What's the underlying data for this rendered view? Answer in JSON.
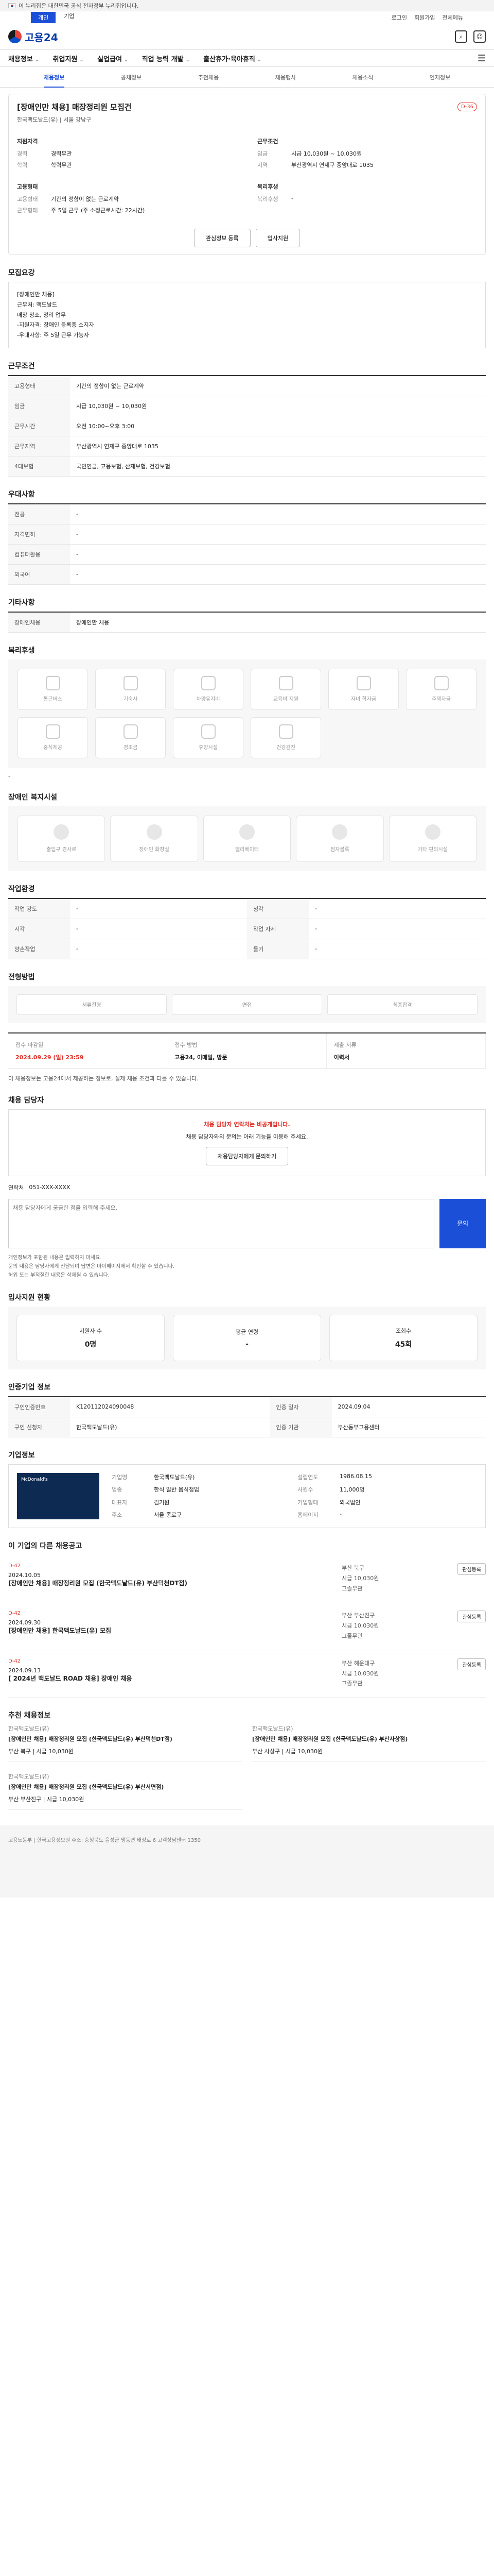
{
  "gov_strip": "이 누리집은 대한민국 공식 전자정부 누리집입니다.",
  "topbar": {
    "tabs": [
      "개인",
      "기업"
    ],
    "right": [
      "로그인",
      "회원가입",
      "전체메뉴"
    ]
  },
  "logo": "고용24",
  "gnb": [
    "채용정보",
    "취업지원",
    "실업급여",
    "직업 능력 개발",
    "출산휴가·육아휴직"
  ],
  "subnav": [
    "채용정보",
    "공채정보",
    "추천채용",
    "채용행사",
    "채용소식",
    "인재정보"
  ],
  "job": {
    "title": "[장애인만 채용] 매장정리원 모집건",
    "dday": "D-36",
    "company_line": "한국맥도날드(유)  |  서울 강남구",
    "left_head": "지원자격",
    "right_head": "근무조건",
    "left": [
      [
        "경력",
        "경력무관"
      ],
      [
        "학력",
        "학력무관"
      ]
    ],
    "right": [
      [
        "임금",
        "시급 10,030원 ~ 10,030원"
      ],
      [
        "지역",
        "부산광역시 연제구 중앙대로 1035"
      ]
    ],
    "left2_head": "고용형태",
    "left2": [
      [
        "고용형태",
        "기간의 정함이 없는 근로계약"
      ],
      [
        "근무형태",
        "주 5일 근무 (주 소정근로시간: 22시간)"
      ]
    ],
    "right2_head": "복리후생",
    "right2": [
      [
        "복리후생",
        "-"
      ]
    ],
    "buttons": [
      "관심정보 등록",
      "입사지원"
    ]
  },
  "section_recruit": "모집요강",
  "recruit_box": "[장애인만 채용]\n근무처: 맥도날드\n매장 청소, 정리 업무\n-지원자격: 장애인 등록증 소지자\n-우대사항: 주 5일 근무 가능자",
  "section_conditions": "근무조건",
  "conditions": [
    [
      "고용형태",
      "기간의 정함이 없는 근로계약"
    ],
    [
      "임금",
      "시급 10,030원 ~ 10,030원"
    ],
    [
      "근무시간",
      "오전 10:00~오후 3:00"
    ],
    [
      "근무지역",
      "부산광역시 연제구 중앙대로 1035"
    ],
    [
      "4대보험",
      "국민연금, 고용보험, 산재보험, 건강보험"
    ]
  ],
  "section_qual": "우대사항",
  "qual": [
    [
      "전공",
      "-"
    ],
    [
      "자격면허",
      "-"
    ],
    [
      "컴퓨터활용",
      "-"
    ],
    [
      "외국어",
      "-"
    ]
  ],
  "section_etc": "기타사항",
  "etc": [
    [
      "장애인채용",
      "장애인만 채용"
    ]
  ],
  "section_welfare_env": "복리후생",
  "welfare_icons": [
    "통근버스",
    "기숙사",
    "차량유지비",
    "교육비 지원",
    "자녀 학자금",
    "주택자금",
    "중식제공",
    "경조금",
    "휴양시설",
    "건강검진",
    "",
    ""
  ],
  "section_disabled": "장애인 복지시설",
  "disabled_icons": [
    "출입구 경사로",
    "장애인 화장실",
    "엘리베이터",
    "점자블록",
    "기타 편의시설"
  ],
  "section_work": "작업환경",
  "work": [
    [
      "작업 강도",
      "-"
    ],
    [
      "청각",
      "-"
    ],
    [
      "시각",
      "-"
    ],
    [
      "작업 자세",
      "-"
    ],
    [
      "양손작업",
      "-"
    ],
    [
      "들기",
      "-"
    ]
  ],
  "section_process": "전형방법",
  "process": [
    "서류전형",
    "면접",
    "최종합격"
  ],
  "apply": {
    "end_label": "접수 마감일",
    "end_value": "2024.09.29 (일) 23:59",
    "method_label": "접수 방법",
    "method_value": "고용24, 이메일, 방문",
    "docs_label": "제출 서류",
    "docs_value": "이력서"
  },
  "apply_note": "이 채용정보는 고용24에서 제공하는 정보로, 실제 채용 조건과 다를 수 있습니다.",
  "section_manager": "채용 담당자",
  "manager_warn": "채용 담당자 연락처는 비공개입니다.",
  "manager_text": "채용 담당자와의 문의는 아래 기능을 이용해 주세요.",
  "manager_button": "채용담당자에게 문의하기",
  "field_label": "연락처",
  "field_value": "051-XXX-XXXX",
  "qa_placeholder": "채용 담당자에게 궁금한 점을 입력해 주세요.",
  "qa_send": "문의",
  "bullets": [
    "개인정보가 포함된 내용은 입력하지 마세요.",
    "문의 내용은 담당자에게 전달되며 답변은 마이페이지에서 확인할 수 있습니다.",
    "허위 또는 부적절한 내용은 삭제될 수 있습니다."
  ],
  "section_status": "입사지원 현황",
  "stats": [
    [
      "지원자 수",
      "0명"
    ],
    [
      "평균 연령",
      "-"
    ],
    [
      "조회수",
      "45회"
    ]
  ],
  "section_info": "인증기업 정보",
  "info": [
    [
      "구인인증번호",
      "K120112024090048"
    ],
    [
      "인증 일자",
      "2024.09.04"
    ],
    [
      "구인 신청자",
      "한국맥도날드(유)"
    ],
    [
      "인증 기관",
      "부산동부고용센터"
    ]
  ],
  "section_company": "기업정보",
  "company_logo_text": "McDonald's",
  "company": [
    [
      "기업명",
      "한국맥도날드(유)"
    ],
    [
      "업종",
      "한식 일반 음식점업"
    ],
    [
      "대표자",
      "김기원"
    ],
    [
      "설립연도",
      "1986.08.15"
    ],
    [
      "사원수",
      "11,000명"
    ],
    [
      "기업형태",
      "외국법인"
    ],
    [
      "주소",
      "서울 종로구"
    ],
    [
      "홈페이지",
      "-"
    ]
  ],
  "section_other": "이 기업의 다른 채용공고",
  "other_jobs": [
    {
      "dday": "D-42",
      "date": "2024.10.05",
      "title": "[장애인만 채용] 매장정리원 모집 (한국맥도날드(유) 부산덕천DT점)",
      "meta": [
        "부산 북구",
        "시급 10,030원",
        "고졸무관"
      ],
      "fav": "관심등록"
    },
    {
      "dday": "D-42",
      "date": "2024.09.30",
      "title": "[장애인만 채용] 한국맥도날드(유) 모집",
      "meta": [
        "부산 부산진구",
        "시급 10,030원",
        "고졸무관"
      ],
      "fav": "관심등록"
    },
    {
      "dday": "D-42",
      "date": "2024.09.13",
      "title": "[ 2024년 맥도날드 ROAD 채용] 장애인 채용",
      "meta": [
        "부산 해운대구",
        "시급 10,030원",
        "고졸무관"
      ],
      "fav": "관심등록"
    }
  ],
  "section_rec": "추천 채용정보",
  "rec": [
    {
      "company": "한국맥도날드(유)",
      "title": "[장애인만 채용] 매장정리원 모집 (한국맥도날드(유) 부산덕천DT점)",
      "meta": "부산 북구 | 시급 10,030원"
    },
    {
      "company": "한국맥도날드(유)",
      "title": "[장애인만 채용] 매장정리원 모집 (한국맥도날드(유) 부산사상점)",
      "meta": "부산 사상구 | 시급 10,030원"
    },
    {
      "company": "한국맥도날드(유)",
      "title": "[장애인만 채용] 매장정리원 모집 (한국맥도날드(유) 부산서면점)",
      "meta": "부산 부산진구 | 시급 10,030원"
    }
  ],
  "footer": "고용노동부 | 한국고용정보원  주소: 충청북도 음성군 맹동면 태정로 6  고객상담센터 1350"
}
